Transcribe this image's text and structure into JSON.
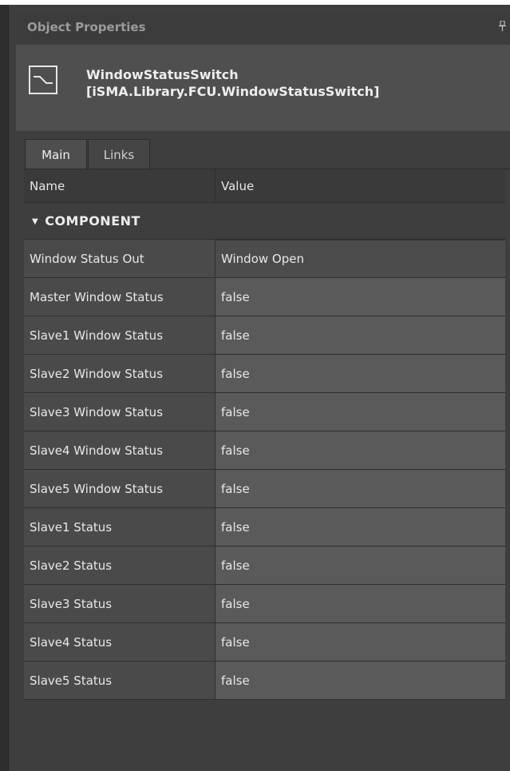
{
  "panel": {
    "title": "Object Properties",
    "pin_glyph": "ᴘ"
  },
  "object": {
    "icon": "switch-icon",
    "name": "WindowStatusSwitch",
    "type": "[iSMA.Library.FCU.WindowStatusSwitch]"
  },
  "tabs": [
    {
      "label": "Main"
    },
    {
      "label": "Links"
    }
  ],
  "grid": {
    "columns": {
      "name": "Name",
      "value": "Value"
    },
    "section": "COMPONENT",
    "rows": [
      {
        "name": "Window Status Out",
        "value": "Window Open"
      },
      {
        "name": "Master Window Status",
        "value": "false"
      },
      {
        "name": "Slave1 Window Status",
        "value": "false"
      },
      {
        "name": "Slave2 Window Status",
        "value": "false"
      },
      {
        "name": "Slave3 Window Status",
        "value": "false"
      },
      {
        "name": "Slave4 Window Status",
        "value": "false"
      },
      {
        "name": "Slave5 Window Status",
        "value": "false"
      },
      {
        "name": "Slave1 Status",
        "value": "false"
      },
      {
        "name": "Slave2 Status",
        "value": "false"
      },
      {
        "name": "Slave3 Status",
        "value": "false"
      },
      {
        "name": "Slave4 Status",
        "value": "false"
      },
      {
        "name": "Slave5 Status",
        "value": "false"
      }
    ]
  }
}
